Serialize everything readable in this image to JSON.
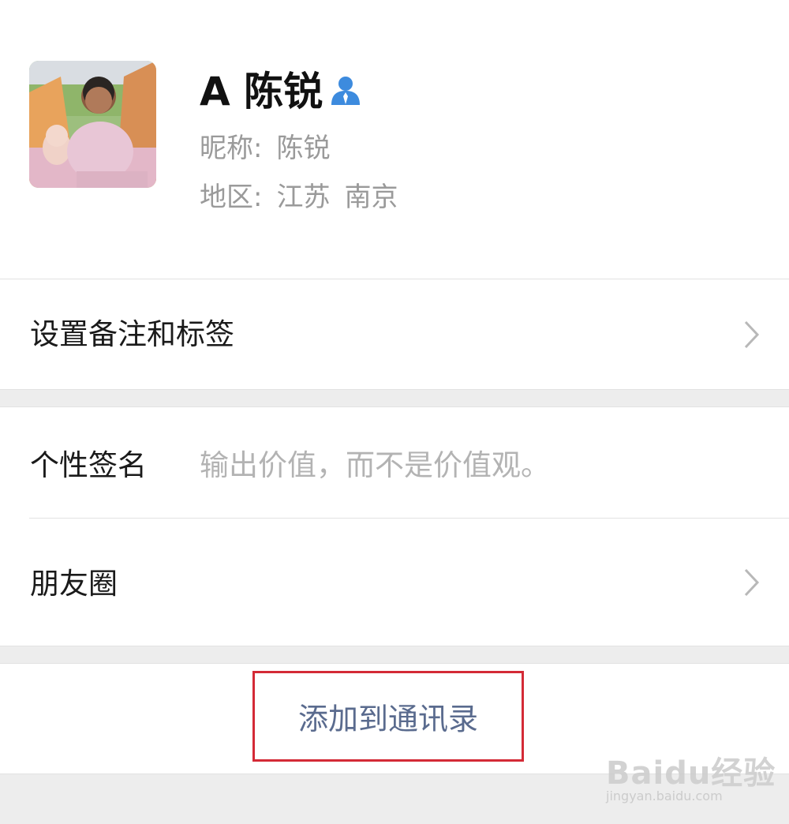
{
  "profile": {
    "display_name": "A 陈锐",
    "nickname_label": "昵称:",
    "nickname_value": "陈锐",
    "region_label": "地区:",
    "region_province": "江苏",
    "region_city": "南京",
    "badge_icon": "person-icon",
    "badge_color": "#3d8bde"
  },
  "rows": {
    "remark_label": "设置备注和标签",
    "signature_label": "个性签名",
    "signature_value": "输出价值，而不是价值观。",
    "moments_label": "朋友圈"
  },
  "actions": {
    "add_to_contacts": "添加到通讯录",
    "highlight_color": "#d42a36",
    "link_color": "#5a6b8e"
  },
  "watermark": {
    "brand": "Baidu经验",
    "domain": "jingyan.baidu.com"
  }
}
